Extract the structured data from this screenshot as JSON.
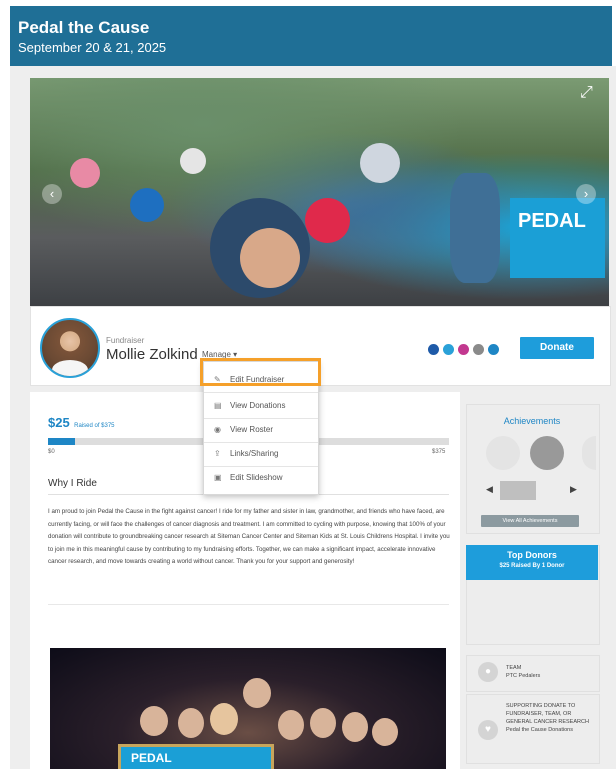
{
  "event": {
    "title": "Pedal the Cause",
    "dates": "September 20 & 21, 2025"
  },
  "profile": {
    "role": "Fundraiser",
    "name": "Mollie Zolkind",
    "manage_label": "Manage ▾",
    "donate_label": "Donate"
  },
  "social_icons": [
    {
      "name": "facebook-icon",
      "color": "#1e5aa8"
    },
    {
      "name": "twitter-icon",
      "color": "#2aa1d8"
    },
    {
      "name": "instagram-icon",
      "color": "#c2388f"
    },
    {
      "name": "email-icon",
      "color": "#8a8a8a"
    },
    {
      "name": "link-icon",
      "color": "#1e86c5"
    }
  ],
  "manage_menu": {
    "items": [
      {
        "icon": "✎",
        "label": "Edit Fundraiser"
      },
      {
        "icon": "▤",
        "label": "View Donations"
      },
      {
        "icon": "◉",
        "label": "View Roster"
      },
      {
        "icon": "⇪",
        "label": "Links/Sharing"
      },
      {
        "icon": "▣",
        "label": "Edit Slideshow"
      }
    ]
  },
  "progress": {
    "raised": "$25",
    "raised_of": "Raised of $375",
    "min": "$0",
    "max": "$375",
    "fraction": 0.067
  },
  "why": {
    "heading": "Why I Ride",
    "text": "I am proud to join Pedal the Cause in the fight against cancer! I ride for my father and sister in law, grandmother, and friends who have faced, are currently facing, or will face the challenges of cancer diagnosis and treatment. I am committed to cycling with purpose, knowing that 100% of your donation will contribute to groundbreaking cancer research at Siteman Cancer Center and Siteman Kids at St. Louis Childrens Hospital. I invite you to join me in this meaningful cause by contributing to my fundraising efforts. Together, we can make a significant impact, accelerate innovative cancer research, and move towards creating a world without cancer. Thank you for your support and generosity!"
  },
  "achievements": {
    "title": "Achievements",
    "view_all": "View All Achievements"
  },
  "top_donors": {
    "title": "Top Donors",
    "subtitle": "$25 Raised By 1 Donor"
  },
  "team": {
    "label": "TEAM",
    "name": "PTC Pedalers"
  },
  "supporting": {
    "label": "SUPPORTING DONATE TO FUNDRAISER, TEAM, OR GENERAL CANCER RESEARCH",
    "name": "Pedal the Cause Donations"
  },
  "hero_banner_text": "PEDAL",
  "photo2_sign_text": "PEDAL"
}
